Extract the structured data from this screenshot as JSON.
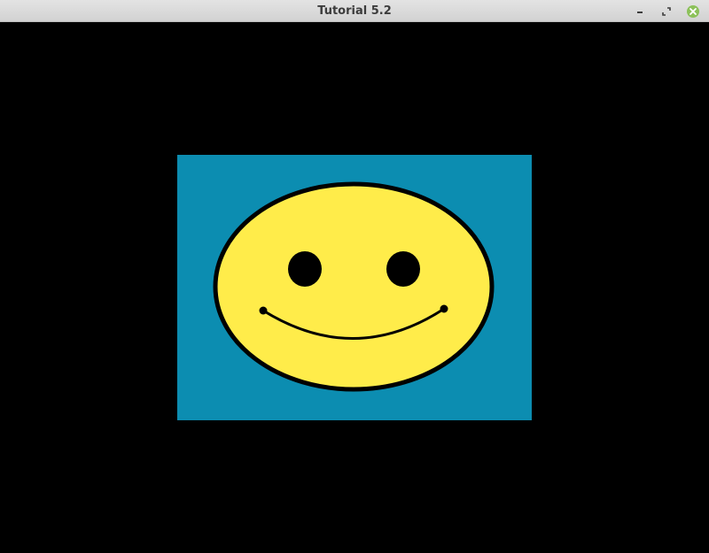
{
  "window": {
    "title": "Tutorial 5.2"
  },
  "icons": {
    "minimize": "minimize-icon",
    "restore": "restore-icon",
    "close": "close-icon"
  },
  "colors": {
    "window_background": "#000000",
    "panel": "#0c8db1",
    "face_fill": "#ffec4a",
    "outline": "#000000",
    "close_button": "#8cc15a"
  }
}
